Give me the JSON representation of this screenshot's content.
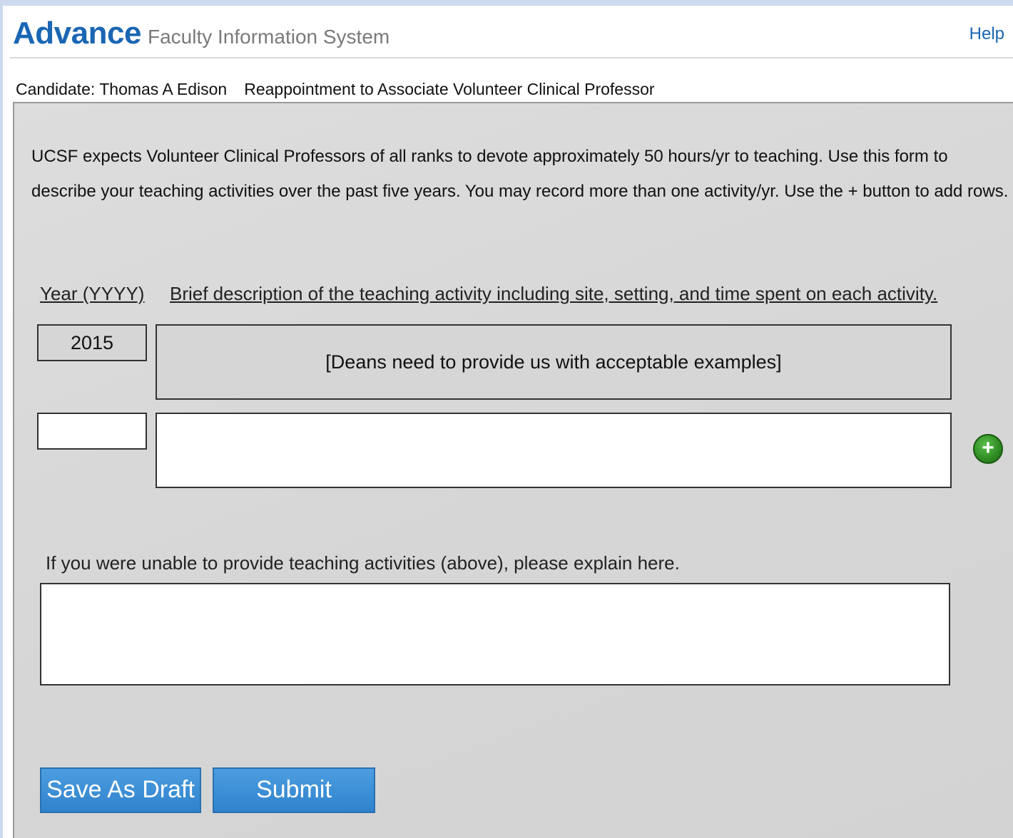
{
  "header": {
    "brand": "Advance",
    "subtitle": "Faculty Information System",
    "help_label": "Help"
  },
  "candidate": {
    "name_text": "Candidate: Thomas A Edison",
    "action_text": "Reappointment to Associate Volunteer Clinical Professor"
  },
  "form": {
    "intro_text": "UCSF expects Volunteer Clinical Professors of all ranks to devote approximately 50 hours/yr to teaching. Use this form to describe your teaching activities over the past five years. You may record more than one activity/yr. Use the + button to add rows.",
    "year_header": "Year (YYYY)",
    "description_header": "Brief description of the teaching activity including site, setting, and time spent on each activity.",
    "rows": [
      {
        "year": "2015",
        "description": "[Deans need to provide us with acceptable examples]"
      },
      {
        "year": "",
        "description": ""
      }
    ],
    "add_row_symbol": "+",
    "add_row_icon": "plus-circle-icon",
    "explain_label": "If you were unable to provide teaching activities (above), please explain here.",
    "explain_value": ""
  },
  "actions": {
    "save_draft_label": "Save As Draft",
    "submit_label": "Submit"
  },
  "colors": {
    "brand_blue": "#1a66b3",
    "button_blue": "#3a8ad4",
    "add_green": "#2e8b23",
    "panel_gray": "#d9d9d9"
  }
}
